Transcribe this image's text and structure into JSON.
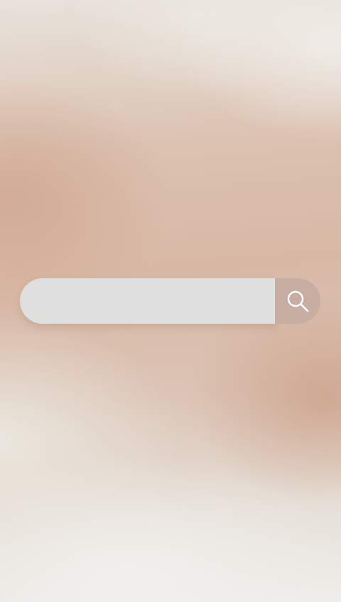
{
  "search": {
    "value": "",
    "placeholder": "",
    "button_icon": "search-icon",
    "colors": {
      "field": "#e0dfdf",
      "button": "#c8ada3",
      "icon": "#ffffff"
    }
  },
  "background": {
    "colors": [
      "#e8e3dc",
      "#d8b8a5",
      "#efedea"
    ]
  }
}
